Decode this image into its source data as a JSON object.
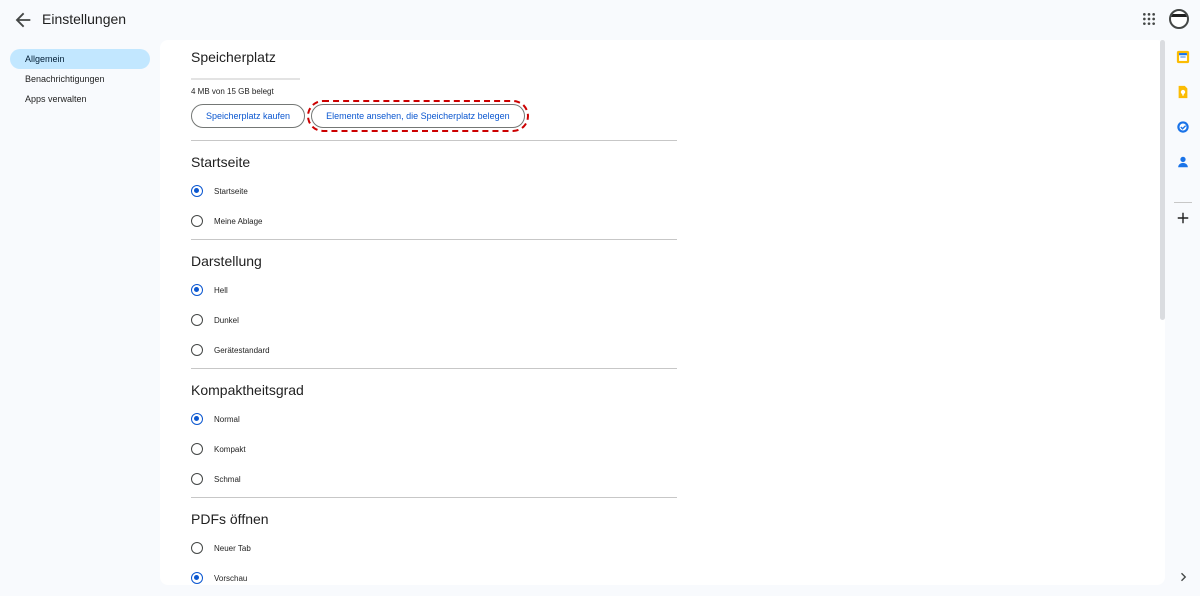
{
  "header": {
    "title": "Einstellungen"
  },
  "nav": [
    {
      "label": "Allgemein",
      "active": true
    },
    {
      "label": "Benachrichtigungen",
      "active": false
    },
    {
      "label": "Apps verwalten",
      "active": false
    }
  ],
  "storage": {
    "title": "Speicherplatz",
    "usage": "4 MB von 15 GB belegt",
    "buy_label": "Speicherplatz kaufen",
    "view_label": "Elemente ansehen, die Speicherplatz belegen"
  },
  "startpage": {
    "title": "Startseite",
    "options": [
      {
        "label": "Startseite",
        "checked": true
      },
      {
        "label": "Meine Ablage",
        "checked": false
      }
    ]
  },
  "appearance": {
    "title": "Darstellung",
    "options": [
      {
        "label": "Hell",
        "checked": true
      },
      {
        "label": "Dunkel",
        "checked": false
      },
      {
        "label": "Gerätestandard",
        "checked": false
      }
    ]
  },
  "density": {
    "title": "Kompaktheitsgrad",
    "options": [
      {
        "label": "Normal",
        "checked": true
      },
      {
        "label": "Kompakt",
        "checked": false
      },
      {
        "label": "Schmal",
        "checked": false
      }
    ]
  },
  "pdf": {
    "title": "PDFs öffnen",
    "options": [
      {
        "label": "Neuer Tab",
        "checked": false
      },
      {
        "label": "Vorschau",
        "checked": true
      }
    ]
  },
  "colors": {
    "accent": "#0b57d0",
    "nav_active": "#c2e7ff"
  },
  "rail_icons": [
    "calendar-icon",
    "keep-icon",
    "tasks-icon",
    "contacts-icon",
    "add-icon",
    "chevron-right-icon"
  ]
}
